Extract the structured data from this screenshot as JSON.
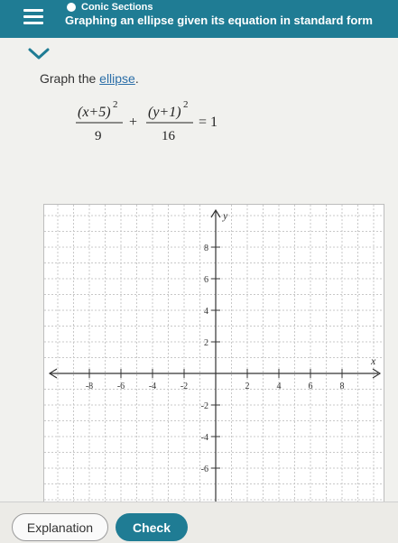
{
  "header": {
    "section": "Conic Sections",
    "topic": "Graphing an ellipse given its equation in standard form"
  },
  "prompt": {
    "before": "Graph the ",
    "link": "ellipse",
    "after": "."
  },
  "equation": {
    "term1_num_a": "(x+5)",
    "term1_exp": "2",
    "term1_den": "9",
    "plus": "+",
    "term2_num_a": "(y+1)",
    "term2_exp": "2",
    "term2_den": "16",
    "equals": "= 1"
  },
  "graph": {
    "x_label": "x",
    "y_label": "y",
    "x_range": [
      -10,
      10
    ],
    "y_range": [
      -8,
      10
    ],
    "x_tick_labels": [
      {
        "value": -8,
        "text": "-8"
      },
      {
        "value": -6,
        "text": "-6"
      },
      {
        "value": -4,
        "text": "-4"
      },
      {
        "value": -2,
        "text": "-2"
      },
      {
        "value": 2,
        "text": "2"
      },
      {
        "value": 4,
        "text": "4"
      },
      {
        "value": 6,
        "text": "6"
      },
      {
        "value": 8,
        "text": "8"
      }
    ],
    "y_tick_labels": [
      {
        "value": 8,
        "text": "8"
      },
      {
        "value": 6,
        "text": "6"
      },
      {
        "value": 4,
        "text": "4"
      },
      {
        "value": 2,
        "text": "2"
      },
      {
        "value": -2,
        "text": "-2"
      },
      {
        "value": -4,
        "text": "-4"
      },
      {
        "value": -6,
        "text": "-6"
      }
    ],
    "grid": true
  },
  "buttons": {
    "explanation": "Explanation",
    "check": "Check"
  }
}
